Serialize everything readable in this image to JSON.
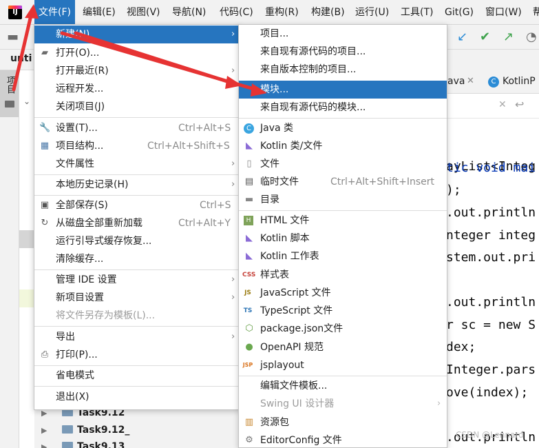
{
  "menubar": {
    "items": [
      "文件(F)",
      "编辑(E)",
      "视图(V)",
      "导航(N)",
      "代码(C)",
      "重构(R)",
      "构建(B)",
      "运行(U)",
      "工具(T)",
      "Git(G)",
      "窗口(W)",
      "帮"
    ]
  },
  "project_name": "unti",
  "sidebar_tab": "项目",
  "file_menu": {
    "items": [
      {
        "label": "新建(N)",
        "shortcut": "",
        "icon": "none",
        "submenu": true
      },
      {
        "label": "打开(O)...",
        "shortcut": "",
        "icon": "folder-open-icon",
        "submenu": false
      },
      {
        "label": "打开最近(R)",
        "shortcut": "",
        "icon": "none",
        "submenu": true
      },
      {
        "label": "远程开发...",
        "shortcut": "",
        "icon": "none",
        "submenu": false
      },
      {
        "label": "关闭项目(J)",
        "shortcut": "",
        "icon": "none",
        "submenu": false
      },
      {
        "label": "设置(T)...",
        "shortcut": "Ctrl+Alt+S",
        "icon": "wrench-icon",
        "submenu": false
      },
      {
        "label": "项目结构...",
        "shortcut": "Ctrl+Alt+Shift+S",
        "icon": "project-structure-icon",
        "submenu": false
      },
      {
        "label": "文件属性",
        "shortcut": "",
        "icon": "none",
        "submenu": true
      },
      {
        "label": "本地历史记录(H)",
        "shortcut": "",
        "icon": "none",
        "submenu": true
      },
      {
        "label": "全部保存(S)",
        "shortcut": "Ctrl+S",
        "icon": "save-icon",
        "submenu": false
      },
      {
        "label": "从磁盘全部重新加载",
        "shortcut": "Ctrl+Alt+Y",
        "icon": "reload-icon",
        "submenu": false
      },
      {
        "label": "运行引导式缓存恢复...",
        "shortcut": "",
        "icon": "none",
        "submenu": false
      },
      {
        "label": "清除缓存...",
        "shortcut": "",
        "icon": "none",
        "submenu": false
      },
      {
        "label": "管理 IDE 设置",
        "shortcut": "",
        "icon": "none",
        "submenu": true
      },
      {
        "label": "新项目设置",
        "shortcut": "",
        "icon": "none",
        "submenu": true
      },
      {
        "label": "将文件另存为模板(L)...",
        "shortcut": "",
        "icon": "none",
        "submenu": false
      },
      {
        "label": "导出",
        "shortcut": "",
        "icon": "none",
        "submenu": true
      },
      {
        "label": "打印(P)...",
        "shortcut": "",
        "icon": "print-icon",
        "submenu": false
      },
      {
        "label": "省电模式",
        "shortcut": "",
        "icon": "none",
        "submenu": false
      },
      {
        "label": "退出(X)",
        "shortcut": "",
        "icon": "none",
        "submenu": false
      }
    ]
  },
  "new_menu": {
    "items": [
      {
        "label": "项目...",
        "shortcut": "",
        "icon": "none"
      },
      {
        "label": "来自现有源代码的项目...",
        "shortcut": "",
        "icon": "none"
      },
      {
        "label": "来自版本控制的项目...",
        "shortcut": "",
        "icon": "none"
      },
      {
        "label": "模块...",
        "shortcut": "",
        "icon": "none"
      },
      {
        "label": "来自现有源代码的模块...",
        "shortcut": "",
        "icon": "none"
      },
      {
        "label": "Java 类",
        "shortcut": "",
        "icon": "java-class-icon"
      },
      {
        "label": "Kotlin 类/文件",
        "shortcut": "",
        "icon": "kotlin-file-icon"
      },
      {
        "label": "文件",
        "shortcut": "",
        "icon": "file-icon"
      },
      {
        "label": "临时文件",
        "shortcut": "Ctrl+Alt+Shift+Insert",
        "icon": "scratch-file-icon"
      },
      {
        "label": "目录",
        "shortcut": "",
        "icon": "directory-icon"
      },
      {
        "label": "HTML 文件",
        "shortcut": "",
        "icon": "html-file-icon"
      },
      {
        "label": "Kotlin 脚本",
        "shortcut": "",
        "icon": "kotlin-script-icon"
      },
      {
        "label": "Kotlin 工作表",
        "shortcut": "",
        "icon": "kotlin-worksheet-icon"
      },
      {
        "label": "样式表",
        "shortcut": "",
        "icon": "css-icon"
      },
      {
        "label": "JavaScript 文件",
        "shortcut": "",
        "icon": "javascript-icon"
      },
      {
        "label": "TypeScript 文件",
        "shortcut": "",
        "icon": "typescript-icon"
      },
      {
        "label": "package.json文件",
        "shortcut": "",
        "icon": "nodejs-icon"
      },
      {
        "label": "OpenAPI 规范",
        "shortcut": "",
        "icon": "openapi-icon"
      },
      {
        "label": "jsplayout",
        "shortcut": "",
        "icon": "jsp-icon"
      },
      {
        "label": "编辑文件模板...",
        "shortcut": "",
        "icon": "none"
      },
      {
        "label": "Swing UI 设计器",
        "shortcut": "",
        "icon": "none"
      },
      {
        "label": "资源包",
        "shortcut": "",
        "icon": "resource-bundle-icon"
      },
      {
        "label": "EditorConfig 文件",
        "shortcut": "",
        "icon": "gear-icon"
      }
    ]
  },
  "tree_items": [
    "Task9.12",
    "Task9.12_",
    "Task9.13"
  ],
  "editor": {
    "tab1": "ava",
    "tab2": "KotlinP",
    "code_lines": [
      "ayList<Integ",
      "tic void mai",
      ");",
      ".out.println",
      "nteger integ",
      "stem.out.pri",
      "",
      ".out.println",
      "r sc = new S",
      "dex;",
      "Integer.pars",
      "ove(index);",
      "",
      ".out.println"
    ]
  },
  "watermark": "CSDN @Lennard",
  "colors": {
    "selection": "#2675bf",
    "arrow": "#e63333"
  }
}
